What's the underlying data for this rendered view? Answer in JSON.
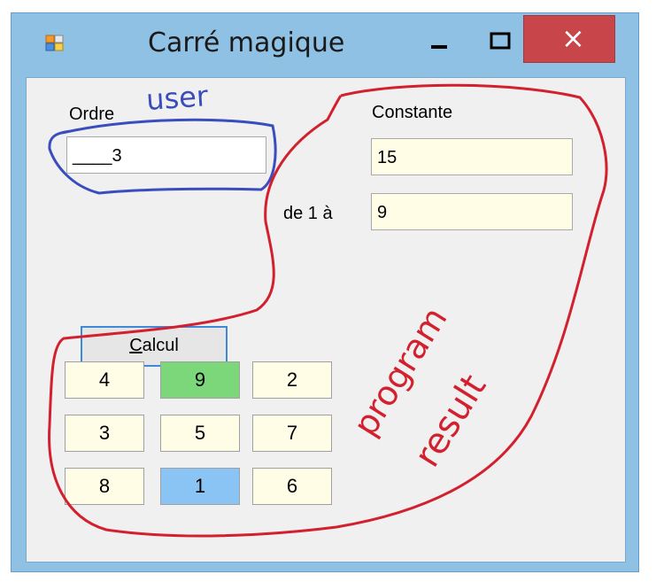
{
  "window": {
    "title": "Carré magique",
    "close_glyph": "×",
    "colors": {
      "titlebar": "#8fc1e5",
      "close": "#c8454a",
      "input_bg": "#fffde6",
      "green": "#7cd77a",
      "blue": "#89c4f4"
    }
  },
  "form": {
    "order_label": "Ordre",
    "order_value": "____3",
    "constant_label": "Constante",
    "constant_value": "15",
    "range_label": "de 1 à",
    "range_value": "9",
    "calc_button_accel": "C",
    "calc_button_rest": "alcul"
  },
  "grid": [
    [
      "4",
      "9",
      "2"
    ],
    [
      "3",
      "5",
      "7"
    ],
    [
      "8",
      "1",
      "6"
    ]
  ],
  "annotations": {
    "user": "user",
    "program": "program",
    "result": "result"
  }
}
